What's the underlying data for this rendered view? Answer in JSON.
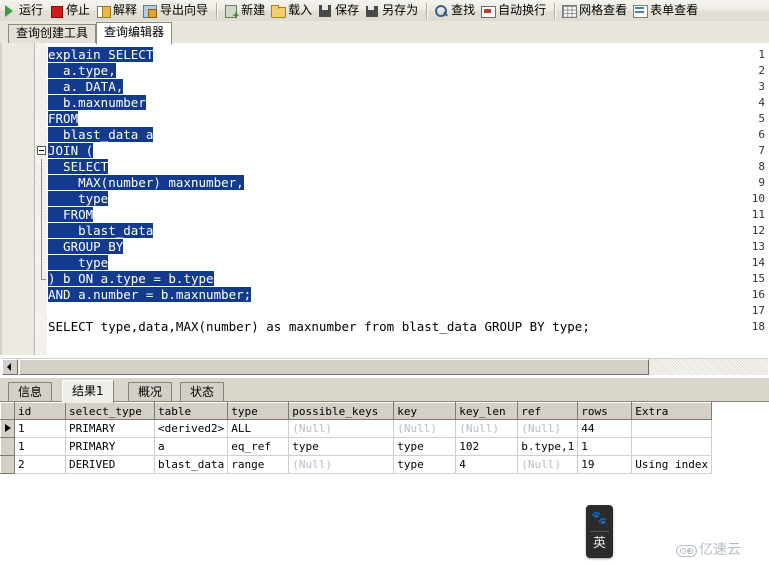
{
  "toolbar": {
    "groups": [
      [
        {
          "icon": "run-icon",
          "label": "运行"
        },
        {
          "icon": "stop-icon",
          "label": "停止"
        },
        {
          "icon": "explain-icon",
          "label": "解释"
        },
        {
          "icon": "export-wizard-icon",
          "label": "导出向导"
        }
      ],
      [
        {
          "icon": "new-icon",
          "label": "新建"
        },
        {
          "icon": "load-icon",
          "label": "载入"
        },
        {
          "icon": "save-icon",
          "label": "保存"
        },
        {
          "icon": "save-as-icon",
          "label": "另存为"
        }
      ],
      [
        {
          "icon": "find-icon",
          "label": "查找"
        },
        {
          "icon": "word-wrap-icon",
          "label": "自动换行"
        }
      ],
      [
        {
          "icon": "grid-view-icon",
          "label": "网格查看"
        },
        {
          "icon": "form-view-icon",
          "label": "表单查看"
        }
      ]
    ]
  },
  "top_tabs": [
    {
      "label": "查询创建工具",
      "active": false
    },
    {
      "label": "查询编辑器",
      "active": true
    }
  ],
  "editor": {
    "lines": [
      {
        "n": "1",
        "indent": 0,
        "text": "explain SELECT",
        "selected": true
      },
      {
        "n": "2",
        "indent": 0,
        "text": "  a.type,",
        "selected": true
      },
      {
        "n": "3",
        "indent": 0,
        "text": "  a. DATA,",
        "selected": true
      },
      {
        "n": "4",
        "indent": 0,
        "text": "  b.maxnumber",
        "selected": true
      },
      {
        "n": "5",
        "indent": 0,
        "text": "FROM",
        "selected": true
      },
      {
        "n": "6",
        "indent": 0,
        "text": "  blast_data a",
        "selected": true
      },
      {
        "n": "7",
        "indent": 0,
        "text": "JOIN (",
        "selected": true,
        "fold": "start"
      },
      {
        "n": "8",
        "indent": 0,
        "text": "  SELECT",
        "selected": true,
        "fold": "mid"
      },
      {
        "n": "9",
        "indent": 0,
        "text": "    MAX(number) maxnumber,",
        "selected": true,
        "fold": "mid"
      },
      {
        "n": "10",
        "indent": 0,
        "text": "    type",
        "selected": true,
        "fold": "mid"
      },
      {
        "n": "11",
        "indent": 0,
        "text": "  FROM",
        "selected": true,
        "fold": "mid"
      },
      {
        "n": "12",
        "indent": 0,
        "text": "    blast_data",
        "selected": true,
        "fold": "mid"
      },
      {
        "n": "13",
        "indent": 0,
        "text": "  GROUP BY",
        "selected": true,
        "fold": "mid"
      },
      {
        "n": "14",
        "indent": 0,
        "text": "    type",
        "selected": true,
        "fold": "mid"
      },
      {
        "n": "15",
        "indent": 0,
        "text": ") b ON a.type = b.type",
        "selected": true,
        "fold": "end"
      },
      {
        "n": "16",
        "indent": 0,
        "text": "AND a.number = b.maxnumber;",
        "selected": true
      },
      {
        "n": "17",
        "indent": 0,
        "text": "",
        "selected": false
      },
      {
        "n": "18",
        "indent": 0,
        "text": "SELECT type,data,MAX(number) as maxnumber from blast_data GROUP BY type;",
        "selected": false
      }
    ]
  },
  "bottom_tabs": [
    {
      "label": "信息",
      "active": false
    },
    {
      "label": "结果1",
      "active": true
    },
    {
      "label": "概况",
      "active": false
    },
    {
      "label": "状态",
      "active": false
    }
  ],
  "result_grid": {
    "columns": [
      "id",
      "select_type",
      "table",
      "type",
      "possible_keys",
      "key",
      "key_len",
      "ref",
      "rows",
      "Extra"
    ],
    "rows": [
      {
        "current": true,
        "cells": [
          {
            "v": "1",
            "null": false
          },
          {
            "v": "PRIMARY",
            "null": false
          },
          {
            "v": "<derived2>",
            "null": false
          },
          {
            "v": "ALL",
            "null": false
          },
          {
            "v": "(Null)",
            "null": true
          },
          {
            "v": "(Null)",
            "null": true
          },
          {
            "v": "(Null)",
            "null": true
          },
          {
            "v": "(Null)",
            "null": true
          },
          {
            "v": "44",
            "null": false
          },
          {
            "v": "",
            "null": false
          }
        ]
      },
      {
        "current": false,
        "cells": [
          {
            "v": "1",
            "null": false
          },
          {
            "v": "PRIMARY",
            "null": false
          },
          {
            "v": "a",
            "null": false
          },
          {
            "v": "eq_ref",
            "null": false
          },
          {
            "v": "type",
            "null": false
          },
          {
            "v": "type",
            "null": false
          },
          {
            "v": "102",
            "null": false
          },
          {
            "v": "b.type,1",
            "null": false
          },
          {
            "v": "1",
            "null": false
          },
          {
            "v": "",
            "null": false
          }
        ]
      },
      {
        "current": false,
        "cells": [
          {
            "v": "2",
            "null": false
          },
          {
            "v": "DERIVED",
            "null": false
          },
          {
            "v": "blast_data",
            "null": false
          },
          {
            "v": "range",
            "null": false
          },
          {
            "v": "(Null)",
            "null": true
          },
          {
            "v": "type",
            "null": false
          },
          {
            "v": "4",
            "null": false
          },
          {
            "v": "(Null)",
            "null": true
          },
          {
            "v": "19",
            "null": false
          },
          {
            "v": "Using index",
            "null": false
          }
        ]
      }
    ]
  },
  "ime": {
    "icon": "paw-icon",
    "mode_label": "英"
  },
  "watermark": {
    "logo": "cloud-icon",
    "text": "亿速云"
  },
  "colors": {
    "selection_blue": "#143a8c",
    "chrome_gray": "#d4d0c8",
    "null_text": "#b9b9c9"
  }
}
